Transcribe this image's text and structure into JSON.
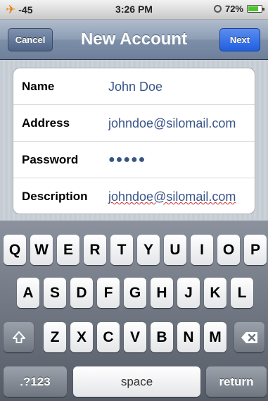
{
  "status_bar": {
    "signal": "-45",
    "time": "3:26 PM",
    "battery": "72%",
    "battery_level": 0.72,
    "airplane_icon": "airplane-icon",
    "clock_icon": "clock-icon",
    "battery_icon": "battery-icon"
  },
  "nav": {
    "cancel_label": "Cancel",
    "title": "New Account",
    "next_label": "Next"
  },
  "form": {
    "rows": [
      {
        "label": "Name",
        "value": "John Doe"
      },
      {
        "label": "Address",
        "value": "johndoe@silomail.com"
      },
      {
        "label": "Password",
        "value": "●●●●●"
      },
      {
        "label": "Description",
        "value": "johndoe@silomail.com"
      }
    ]
  },
  "keyboard": {
    "row1": [
      "Q",
      "W",
      "E",
      "R",
      "T",
      "Y",
      "U",
      "I",
      "O",
      "P"
    ],
    "row2": [
      "A",
      "S",
      "D",
      "F",
      "G",
      "H",
      "J",
      "K",
      "L"
    ],
    "row3": [
      "Z",
      "X",
      "C",
      "V",
      "B",
      "N",
      "M"
    ],
    "shift_icon": "shift-icon",
    "backspace_icon": "backspace-icon",
    "numbers_label": ".?123",
    "space_label": "space",
    "return_label": "return"
  },
  "colors": {
    "value_text": "#385487",
    "next_button": "#1f5fe0",
    "airplane": "#e9820d",
    "battery_fill": "#4bc62a"
  }
}
